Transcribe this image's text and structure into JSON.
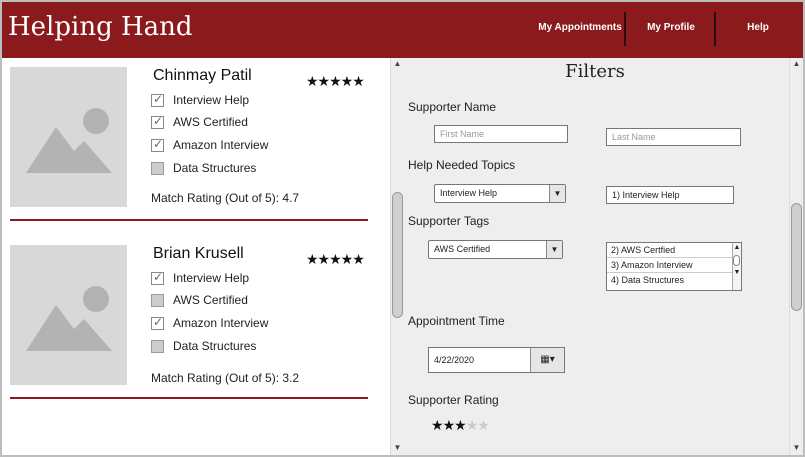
{
  "app": {
    "title": "Helping Hand"
  },
  "nav": {
    "appointments": "My Appointments",
    "profile": "My Profile",
    "help": "Help"
  },
  "supporters": [
    {
      "name": "Chinmay Patil",
      "stars": "★★★★★",
      "tags": [
        {
          "label": "Interview Help",
          "checked": true
        },
        {
          "label": "AWS Certified",
          "checked": true
        },
        {
          "label": "Amazon Interview",
          "checked": true
        },
        {
          "label": "Data Structures",
          "checked": false
        }
      ],
      "match_label": "Match Rating (Out of 5):",
      "match_value": "4.7"
    },
    {
      "name": "Brian Krusell",
      "stars": "★★★★★",
      "tags": [
        {
          "label": "Interview Help",
          "checked": true
        },
        {
          "label": "AWS Certified",
          "checked": false
        },
        {
          "label": "Amazon Interview",
          "checked": true
        },
        {
          "label": "Data Structures",
          "checked": false
        }
      ],
      "match_label": "Match Rating (Out of 5):",
      "match_value": "3.2"
    }
  ],
  "filters": {
    "title": "Filters",
    "supporter_name": {
      "label": "Supporter Name",
      "first_placeholder": "First Name",
      "last_placeholder": "Last Name"
    },
    "help_topics": {
      "label": "Help Needed Topics",
      "selected": "Interview Help",
      "list": [
        "1) Interview Help"
      ]
    },
    "supporter_tags": {
      "label": "Supporter Tags",
      "selected": "AWS Certified",
      "list": [
        "2) AWS Certfied",
        "3) Amazon Interview",
        "4) Data Structures"
      ]
    },
    "appointment_time": {
      "label": "Appointment Time",
      "value": "4/22/2020"
    },
    "supporter_rating": {
      "label": "Supporter Rating",
      "value": 3,
      "max": 5
    }
  },
  "icons": {
    "image_placeholder": "image-placeholder-icon",
    "checkbox_check": "check-icon",
    "dropdown": "chevron-down-icon",
    "calendar": "calendar-icon",
    "scroll_up": "scroll-up-arrow-icon",
    "scroll_down": "scroll-down-arrow-icon",
    "star": "star-icon"
  },
  "colors": {
    "brand": "#8b1a1c",
    "header_text": "#ffffff"
  }
}
